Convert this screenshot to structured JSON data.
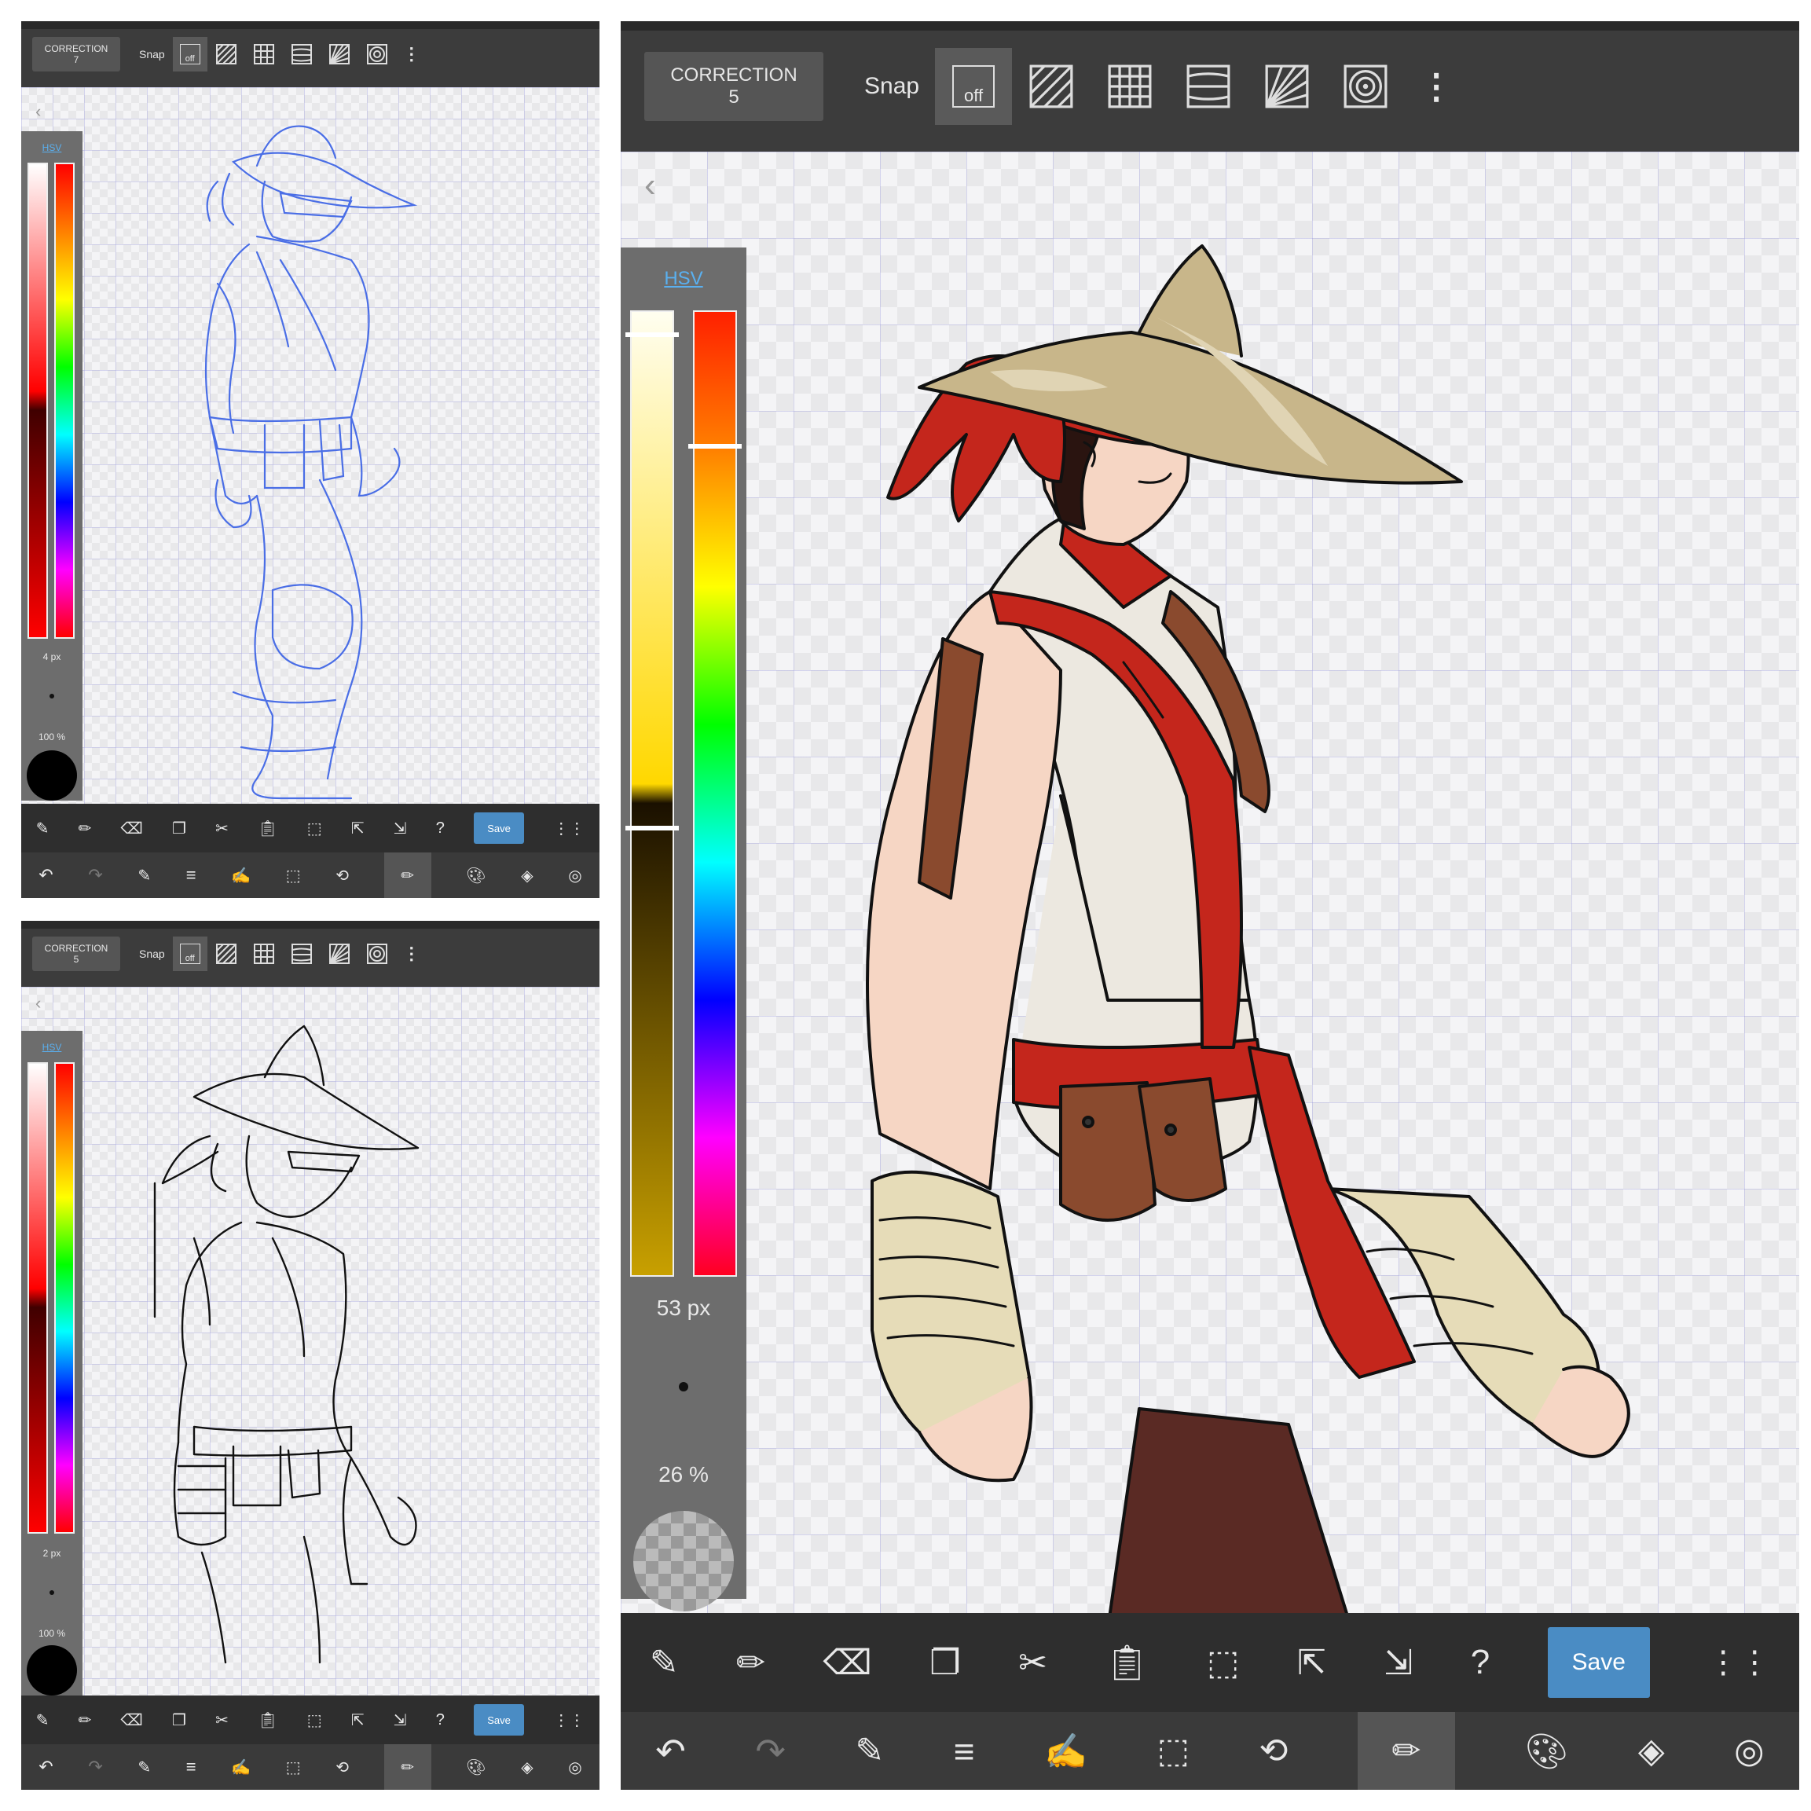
{
  "panels": {
    "sketch": {
      "correction_label": "CORRECTION",
      "correction_value": "7",
      "snap_label": "Snap",
      "snap_off": "off",
      "hsv": "HSV",
      "brush_size": "4 px",
      "opacity": "100 %",
      "save": "Save",
      "line_color": "#4a6ee6"
    },
    "lineart": {
      "correction_label": "CORRECTION",
      "correction_value": "5",
      "snap_label": "Snap",
      "snap_off": "off",
      "hsv": "HSV",
      "brush_size": "2 px",
      "opacity": "100 %",
      "save": "Save",
      "line_color": "#111111"
    },
    "color": {
      "correction_label": "CORRECTION",
      "correction_value": "5",
      "snap_label": "Snap",
      "snap_off": "off",
      "hsv": "HSV",
      "brush_size": "53 px",
      "opacity": "26 %",
      "save": "Save"
    }
  },
  "colors": {
    "accent": "#4a8cc4",
    "hsv_link": "#5ab0f0",
    "hat": "#c8b68a",
    "hat_light": "#e0d4b4",
    "red": "#c4261c",
    "skin": "#f6d6c4",
    "shirt": "#ece8e0",
    "bandage": "#e6dcb8",
    "leather": "#8a4a2e",
    "pants": "#5a2a24",
    "hair": "#2a1410"
  }
}
